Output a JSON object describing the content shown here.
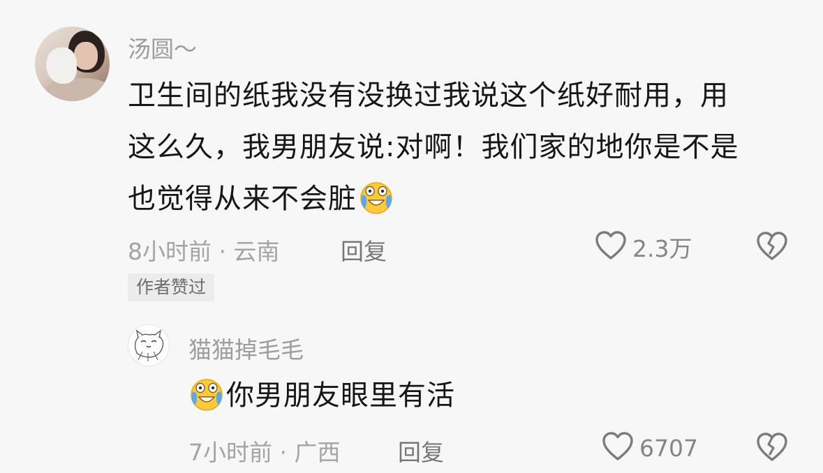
{
  "comments": [
    {
      "username": "汤圆～",
      "content_lines": [
        "卫生间的纸我没有没换过我说这个纸好耐用，用",
        "这么久，我男朋友说:对啊！我们家的地你是不是",
        "也觉得从来不会脏"
      ],
      "trailing_emoji": "crying-laughing-emoji",
      "meta": "8小时前 · 云南",
      "reply_label": "回复",
      "likes": "2.3万",
      "badge": "作者赞过"
    },
    {
      "username": "猫猫掉毛毛",
      "leading_emoji": "crying-laughing-emoji",
      "content": "你男朋友眼里有活",
      "meta": "7小时前 · 广西",
      "reply_label": "回复",
      "likes": "6707"
    }
  ],
  "icons": {
    "like": "heart-outline-icon",
    "dislike": "broken-heart-icon"
  },
  "colors": {
    "background": "#f7f7f7",
    "text": "#161616",
    "muted": "#a4a4a4",
    "emoji_yellow": "#ffc93c",
    "emoji_tear": "#5aa9ef"
  }
}
